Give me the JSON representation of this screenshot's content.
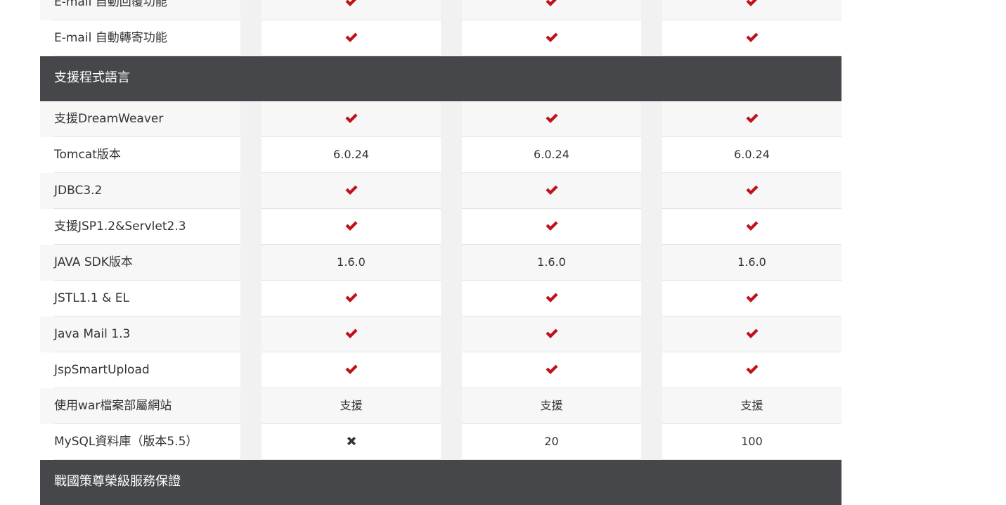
{
  "colors": {
    "check": "#c0101c",
    "cross": "#333333",
    "section_bg": "#45474b",
    "row_alt": "#f7f7f7",
    "gap": "#f1f1f1"
  },
  "top_rows": [
    {
      "label": "E-mail 自動回覆功能",
      "values": [
        "check",
        "check",
        "check"
      ]
    },
    {
      "label": "E-mail 自動轉寄功能",
      "values": [
        "check",
        "check",
        "check"
      ]
    }
  ],
  "section1": {
    "title": "支援程式語言"
  },
  "rows": [
    {
      "label": "支援DreamWeaver",
      "values": [
        "check",
        "check",
        "check"
      ]
    },
    {
      "label": "Tomcat版本",
      "values": [
        "6.0.24",
        "6.0.24",
        "6.0.24"
      ]
    },
    {
      "label": "JDBC3.2",
      "values": [
        "check",
        "check",
        "check"
      ]
    },
    {
      "label": "支援JSP1.2&Servlet2.3",
      "values": [
        "check",
        "check",
        "check"
      ]
    },
    {
      "label": "JAVA SDK版本",
      "values": [
        "1.6.0",
        "1.6.0",
        "1.6.0"
      ]
    },
    {
      "label": "JSTL1.1 & EL",
      "values": [
        "check",
        "check",
        "check"
      ]
    },
    {
      "label": "Java Mail 1.3",
      "values": [
        "check",
        "check",
        "check"
      ]
    },
    {
      "label": "JspSmartUpload",
      "values": [
        "check",
        "check",
        "check"
      ]
    },
    {
      "label": "使用war檔案部屬網站",
      "values": [
        "支援",
        "支援",
        "支援"
      ]
    },
    {
      "label": "MySQL資料庫（版本5.5）",
      "values": [
        "cross",
        "20",
        "100"
      ]
    }
  ],
  "section2": {
    "title": "戰國策尊榮級服務保證"
  }
}
